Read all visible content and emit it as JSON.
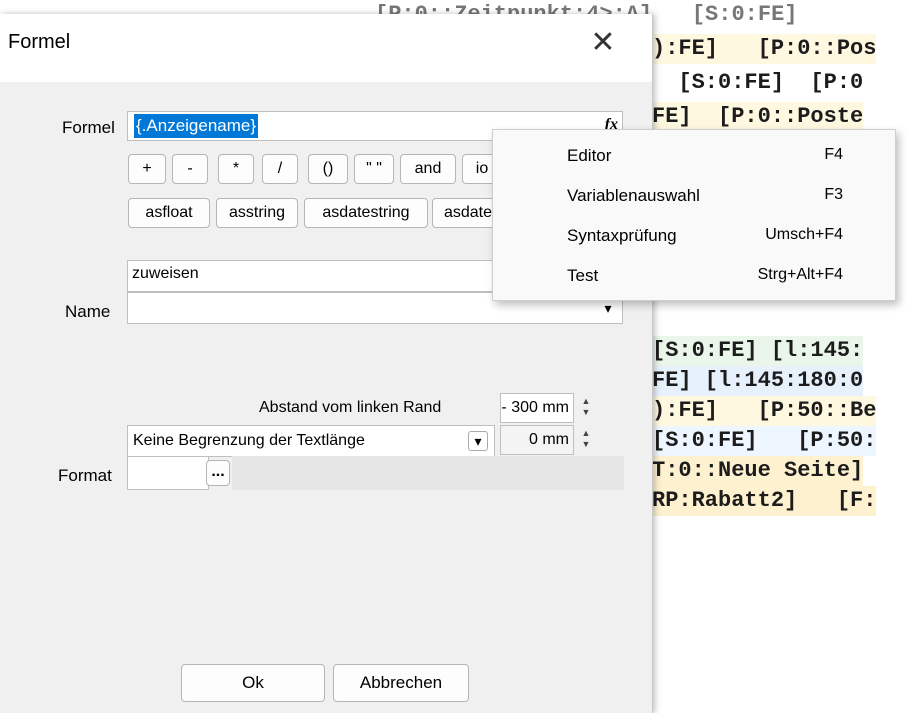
{
  "background_code": [
    "[P:0::Zeitpunkt:4>:A]   [S:0:FE]",
    "):FE]   [P:0::Pos",
    "  [S:0:FE]  [P:0",
    "FE]  [P:0::Poste",
    "[S:0:FE] [l:145:",
    "FE] [l:145:180:0",
    "):FE]   [P:50::Be",
    "[S:0:FE]   [P:50:",
    "T:0::Neue Seite]",
    "RP:Rabatt2]   [F:"
  ],
  "dialog": {
    "title": "Formel",
    "close_glyph": "✕",
    "formel_label": "Formel",
    "formel_value": "{.Anzeigename}",
    "fx_glyph": "fx",
    "operators": [
      "+",
      "-",
      "*",
      "/",
      "()",
      "\" \"",
      "and",
      "io"
    ],
    "functions": [
      "asfloat",
      "asstring",
      "asdatestring",
      "asdate"
    ],
    "zuweisen_value": "zuweisen",
    "name_label": "Name",
    "abstand_label": "Abstand vom linken Rand",
    "abstand_value": "- 300 mm",
    "begrenzung_value": "Keine Begrenzung der Textlänge",
    "laenge_value": "0 mm",
    "format_label": "Format",
    "ellipsis": "...",
    "ok_label": "Ok",
    "cancel_label": "Abbrechen"
  },
  "context_menu": [
    {
      "label": "Editor",
      "shortcut": "F4"
    },
    {
      "label": "Variablenauswahl",
      "shortcut": "F3"
    },
    {
      "label": "Syntaxprüfung",
      "shortcut": "Umsch+F4"
    },
    {
      "label": "Test",
      "shortcut": "Strg+Alt+F4"
    }
  ]
}
